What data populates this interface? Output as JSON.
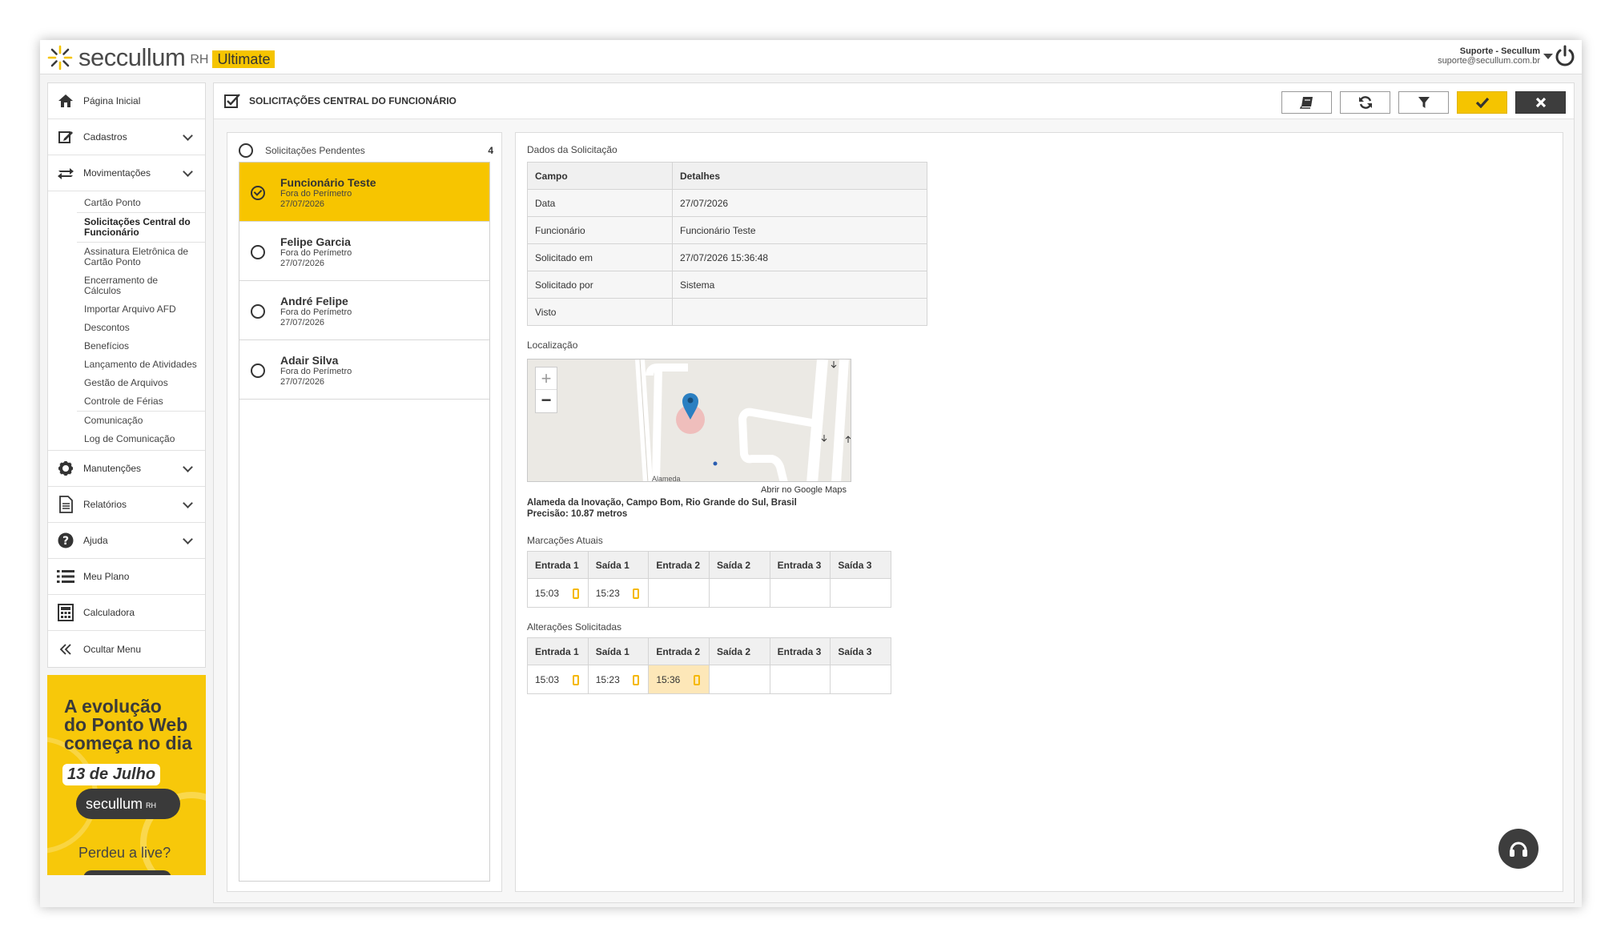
{
  "app": {
    "logo_text": "seccullum",
    "logo_rh": "RH",
    "logo_badge": "Ultimate",
    "user_name": "Suporte - Secullum",
    "user_email": "suporte@secullum.com.br"
  },
  "sidebar": {
    "items": [
      {
        "label": "Página Inicial",
        "icon": "home-icon"
      },
      {
        "label": "Cadastros",
        "icon": "edit-icon"
      },
      {
        "label": "Movimentações",
        "icon": "exchange-icon"
      },
      {
        "label": "Manutenções",
        "icon": "gear-icon"
      },
      {
        "label": "Relatórios",
        "icon": "document-icon"
      },
      {
        "label": "Ajuda",
        "icon": "question-icon"
      },
      {
        "label": "Meu Plano",
        "icon": "list-icon"
      },
      {
        "label": "Calculadora",
        "icon": "calculator-icon"
      },
      {
        "label": "Ocultar Menu",
        "icon": "double-chevron-left-icon"
      }
    ],
    "submenu": [
      "Cartão Ponto",
      "Solicitações Central do Funcionário",
      "Assinatura Eletrônica de Cartão Ponto",
      "Encerramento de Cálculos",
      "Importar Arquivo AFD",
      "Descontos",
      "Benefícios",
      "Lançamento de Atividades",
      "Gestão de Arquivos",
      "Controle de Férias",
      "Comunicação",
      "Log de Comunicação"
    ]
  },
  "promo": {
    "line1": "A evolução",
    "line2": "do Ponto Web",
    "line3": "começa no dia",
    "date": "13 de Julho",
    "logo": "secullum",
    "logo_rh": "RH",
    "footer": "Perdeu a live?"
  },
  "main": {
    "title": "SOLICITAÇÕES CENTRAL DO FUNCIONÁRIO",
    "toolbar": [
      "book-icon",
      "refresh-icon",
      "filter-icon",
      "check-icon",
      "close-icon"
    ]
  },
  "list": {
    "header": "Solicitações Pendentes",
    "count": "4",
    "requests": [
      {
        "name": "Funcionário Teste",
        "type": "Fora do Perímetro",
        "date": "27/07/2026"
      },
      {
        "name": "Felipe Garcia",
        "type": "Fora do Perímetro",
        "date": "27/07/2026"
      },
      {
        "name": "André Felipe",
        "type": "Fora do Perímetro",
        "date": "27/07/2026"
      },
      {
        "name": "Adair Silva",
        "type": "Fora do Perímetro",
        "date": "27/07/2026"
      }
    ]
  },
  "detail": {
    "section_title": "Dados da Solicitação",
    "headers": [
      "Campo",
      "Detalhes"
    ],
    "rows": [
      [
        "Data",
        "27/07/2026"
      ],
      [
        "Funcionário",
        "Funcionário Teste"
      ],
      [
        "Solicitado em",
        "27/07/2026 15:36:48"
      ],
      [
        "Solicitado por",
        "Sistema"
      ],
      [
        "Visto",
        ""
      ]
    ],
    "location_label": "Localização",
    "map_zoom_in": "+",
    "map_zoom_out": "−",
    "map_street": "Alameda",
    "map_link": "Abrir no Google Maps",
    "address": "Alameda da Inovação, Campo Bom, Rio Grande do Sul, Brasil",
    "precision": "Precisão: 10.87 metros",
    "current_label": "Marcações Atuais",
    "requested_label": "Alterações Solicitadas",
    "punch_headers": [
      "Entrada 1",
      "Saída 1",
      "Entrada 2",
      "Saída 2",
      "Entrada 3",
      "Saída 3"
    ],
    "current_values": [
      "15:03",
      "15:23",
      "",
      "",
      "",
      ""
    ],
    "requested_values": [
      "15:03",
      "15:23",
      "15:36",
      "",
      "",
      ""
    ]
  },
  "colors": {
    "accent": "#f5c400",
    "highlight": "#fde7b8",
    "dark": "#3d3d3d"
  }
}
